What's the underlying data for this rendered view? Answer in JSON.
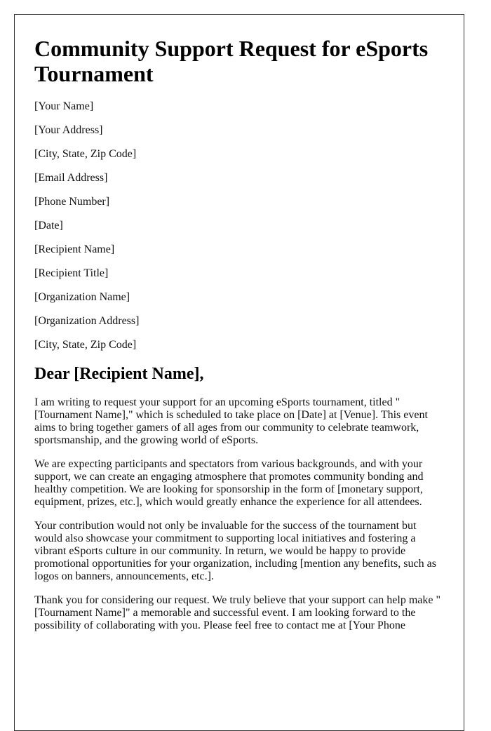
{
  "document": {
    "title": "Community Support Request for eSports Tournament",
    "sender": {
      "name": "[Your Name]",
      "address": "[Your Address]",
      "city_state_zip": "[City, State, Zip Code]",
      "email": "[Email Address]",
      "phone": "[Phone Number]"
    },
    "date": "[Date]",
    "recipient": {
      "name": "[Recipient Name]",
      "title": "[Recipient Title]",
      "organization": "[Organization Name]",
      "organization_address": "[Organization Address]",
      "city_state_zip": "[City, State, Zip Code]"
    },
    "salutation": "Dear [Recipient Name],",
    "paragraphs": [
      "I am writing to request your support for an upcoming eSports tournament, titled \"[Tournament Name],\" which is scheduled to take place on [Date] at [Venue]. This event aims to bring together gamers of all ages from our community to celebrate teamwork, sportsmanship, and the growing world of eSports.",
      "We are expecting participants and spectators from various backgrounds, and with your support, we can create an engaging atmosphere that promotes community bonding and healthy competition. We are looking for sponsorship in the form of [monetary support, equipment, prizes, etc.], which would greatly enhance the experience for all attendees.",
      "Your contribution would not only be invaluable for the success of the tournament but would also showcase your commitment to supporting local initiatives and fostering a vibrant eSports culture in our community. In return, we would be happy to provide promotional opportunities for your organization, including [mention any benefits, such as logos on banners, announcements, etc.].",
      "Thank you for considering our request. We truly believe that your support can help make \"[Tournament Name]\" a memorable and successful event. I am looking forward to the possibility of collaborating with you. Please feel free to contact me at [Your Phone"
    ]
  }
}
